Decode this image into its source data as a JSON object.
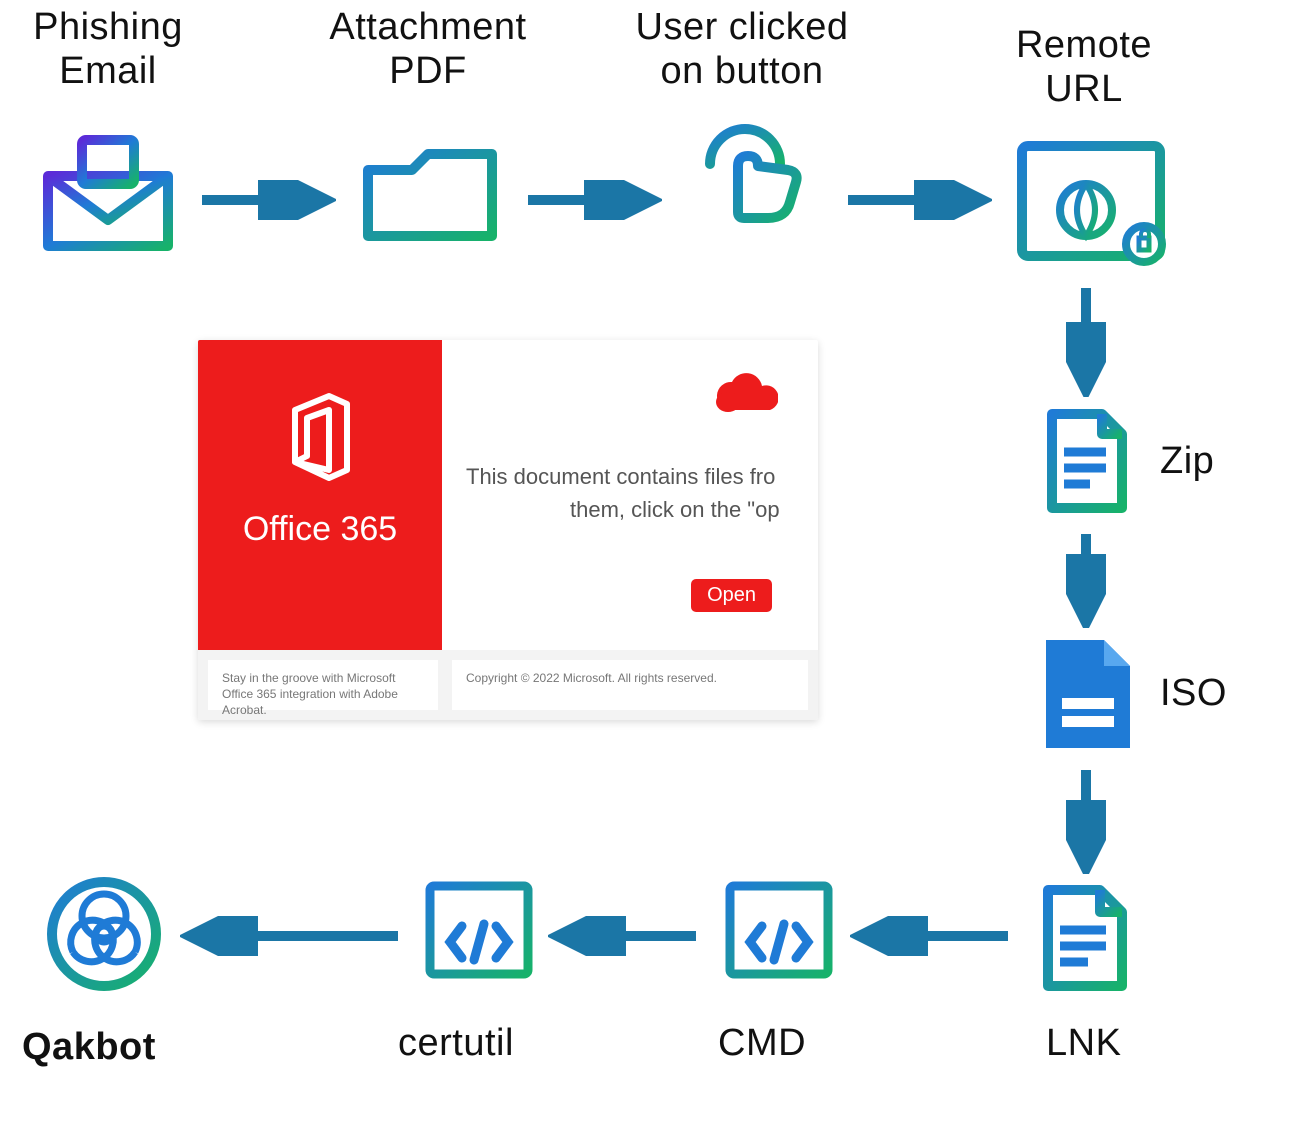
{
  "nodes": {
    "phishing_email": "Phishing\nEmail",
    "attachment_pdf": "Attachment\nPDF",
    "user_clicked": "User clicked\non button",
    "remote_url": "Remote\nURL",
    "zip": "Zip",
    "iso": "ISO",
    "lnk": "LNK",
    "cmd": "CMD",
    "certutil": "certutil",
    "qakbot": "Qakbot"
  },
  "dialog": {
    "brand_title": "Office 365",
    "body_line1": "This document contains files fro",
    "body_line2": "them, click on the \"op",
    "open_label": "Open",
    "footer_a": "Stay in the groove with Microsoft Office 365 integration with Adobe Acrobat.",
    "footer_b": "Copyright © 2022 Microsoft. All rights reserved."
  },
  "colors": {
    "arrow": "#1b76a6",
    "grad_a": "#1f7bd6",
    "grad_b": "#17b26a",
    "office": "#ed1c1c"
  }
}
